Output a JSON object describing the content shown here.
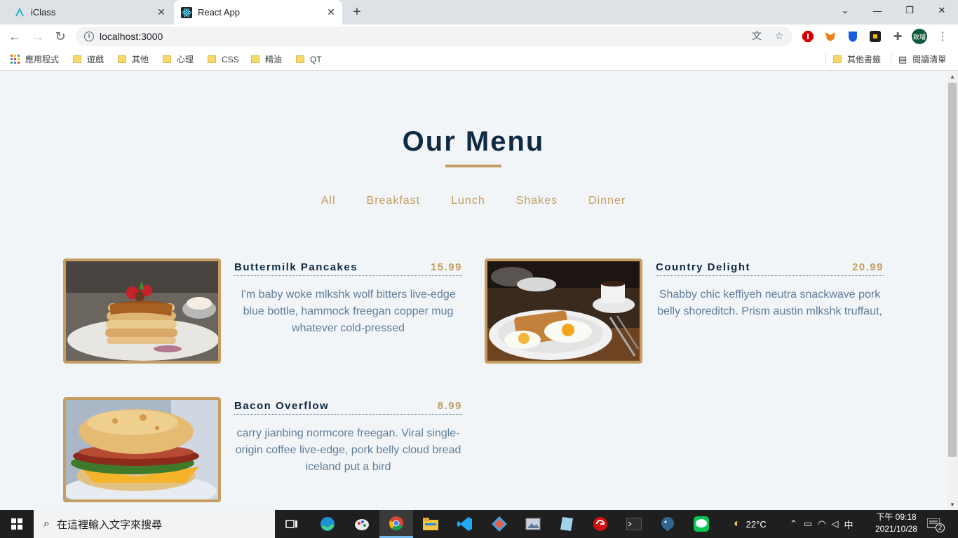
{
  "browser": {
    "tabs": [
      {
        "title": "iClass",
        "active": false
      },
      {
        "title": "React App",
        "active": true
      }
    ],
    "url": "localhost:3000",
    "bookmarks": [
      "應用程式",
      "遊戲",
      "其他",
      "心理",
      "CSS",
      "精油",
      "QT"
    ],
    "other_bookmarks": "其他書籤",
    "reading_list": "閱讀清單",
    "profile_initials": "致璿"
  },
  "page": {
    "title": "Our Menu",
    "filters": [
      "All",
      "Breakfast",
      "Lunch",
      "Shakes",
      "Dinner"
    ],
    "items": [
      {
        "name": "Buttermilk Pancakes",
        "price": "15.99",
        "desc": "I'm baby woke mlkshk wolf bitters live-edge blue bottle, hammock freegan copper mug whatever cold-pressed",
        "image": "pancake-stack-photo"
      },
      {
        "name": "Country Delight",
        "price": "20.99",
        "desc": "Shabby chic keffiyeh neutra snackwave pork belly shoreditch. Prism austin mlkshk truffaut,",
        "image": "eggs-and-toast-photo"
      },
      {
        "name": "Bacon Overflow",
        "price": "8.99",
        "desc": "carry jianbing normcore freegan. Viral single-origin coffee live-edge, pork belly cloud bread iceland put a bird",
        "image": "bacon-biscuit-sandwich-photo"
      }
    ]
  },
  "taskbar": {
    "search_placeholder": "在這裡輸入文字來搜尋",
    "weather": "22°C",
    "ime": "中",
    "time": "下午 09:18",
    "date": "2021/10/28",
    "notifications": "2"
  },
  "colors": {
    "accent": "#c59d5f",
    "heading": "#102a42",
    "text": "#617d98",
    "background": "#f1f5f8"
  }
}
